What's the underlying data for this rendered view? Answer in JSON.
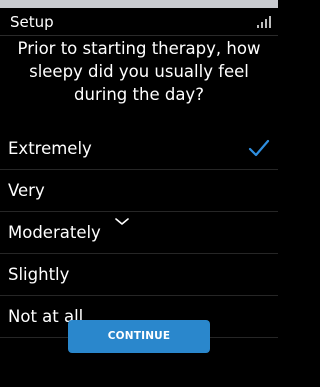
{
  "header": {
    "title": "Setup",
    "signal_icon": "signal-icon"
  },
  "question": {
    "text": "Prior to starting therapy, how sleepy did you usually feel during the day?"
  },
  "options": [
    {
      "label": "Extremely",
      "selected": true
    },
    {
      "label": "Very",
      "selected": false
    },
    {
      "label": "Moderately",
      "selected": false
    },
    {
      "label": "Slightly",
      "selected": false
    },
    {
      "label": "Not at all",
      "selected": false
    }
  ],
  "scroll_hint_icon": "chevron-down-icon",
  "continue_button": {
    "label": "CONTINUE"
  },
  "colors": {
    "background": "#000000",
    "accent": "#2a87cc",
    "check": "#2f8fe0"
  }
}
